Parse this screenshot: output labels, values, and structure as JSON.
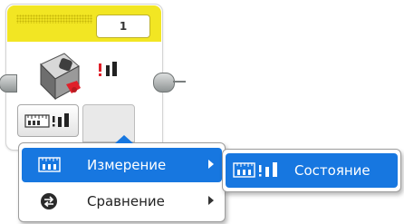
{
  "block": {
    "port_number": "1",
    "colors": {
      "top_bar": "#f2e623",
      "connector": "#8f9494",
      "highlight": "#1777e0",
      "accent_red": "#e0202a"
    },
    "icons": {
      "sensor": "brick-sensor-icon",
      "measure": "measure-state-icon",
      "mode": "ruler-measure-mode-icon"
    }
  },
  "menu": {
    "items": [
      {
        "label": "Измерение",
        "icon": "ruler-123-icon",
        "selected": true
      },
      {
        "label": "Сравнение",
        "icon": "compare-icon",
        "selected": false
      }
    ]
  },
  "submenu": {
    "items": [
      {
        "label": "Состояние",
        "icon": "ruler-state-icon",
        "selected": true
      }
    ]
  }
}
